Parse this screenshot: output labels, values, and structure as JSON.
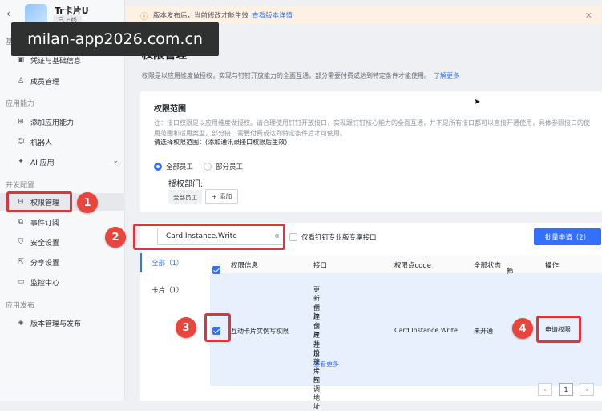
{
  "app": {
    "name": "Tr卡片U",
    "status_tag": "已上线"
  },
  "watermark": "milan-app2026.com.cn",
  "sidebar": {
    "sections": [
      {
        "label": "基础信息",
        "items": [
          {
            "label": "凭证与基础信息",
            "icon": "credential-icon"
          },
          {
            "label": "成员管理",
            "icon": "member-icon"
          }
        ]
      },
      {
        "label": "应用能力",
        "items": [
          {
            "label": "添加应用能力",
            "icon": "grid-icon"
          },
          {
            "label": "机器人",
            "icon": "robot-icon"
          },
          {
            "label": "AI 应用",
            "icon": "ai-icon"
          }
        ]
      },
      {
        "label": "开发配置",
        "items": [
          {
            "label": "权限管理",
            "icon": "permission-icon",
            "active": true
          },
          {
            "label": "事件订阅",
            "icon": "event-icon"
          },
          {
            "label": "安全设置",
            "icon": "shield-icon"
          },
          {
            "label": "分享设置",
            "icon": "share-icon"
          },
          {
            "label": "监控中心",
            "icon": "monitor-icon"
          }
        ]
      },
      {
        "label": "应用发布",
        "items": [
          {
            "label": "版本管理与发布",
            "icon": "version-icon"
          }
        ]
      }
    ]
  },
  "banner": {
    "text": "版本发布后，当前修改才能生效",
    "link": "查看版本详情"
  },
  "page": {
    "title": "权限管理",
    "desc": "权限是以应用维度做授权，实现与钉钉开放能力的全面互通，部分需要付费或达到特定条件才能使用。",
    "desc_link": "了解更多"
  },
  "scope": {
    "title": "权限范围",
    "note": "注：接口权限是以应用维度做授权。请合理使用钉钉开放接口，实现跟钉钉核心能力的全面互通，并不是所有接口都可以直接开通使用，具体参照接口的使用范围和适用类型，部分接口需要付费或达到特定条件后才可使用。",
    "pick": "请选择权限范围：(添加通讯录接口权限后生效)",
    "options": [
      "全部员工",
      "部分员工"
    ],
    "dept_label": "授权部门:",
    "dept_chip": "全部员工",
    "add_label": "+ 添加"
  },
  "search": {
    "value": "Card.Instance.Write",
    "clear": "⊗"
  },
  "pro_only": "仅看钉钉专业版专享接口",
  "batch_label": "批量申请（2）",
  "categories": [
    {
      "label": "全部（1）",
      "active": true
    },
    {
      "label": "卡片（1）"
    }
  ],
  "table": {
    "headers": {
      "info": "权限信息",
      "api": "接口",
      "code": "权限点code",
      "status": "全部状态",
      "filter": "筛选",
      "op": "操作"
    },
    "row": {
      "name": "互动卡片实例写权限",
      "apis": [
        "更新卡片",
        "创建卡片",
        "创建并投放卡片",
        "注册卡片回调地址"
      ],
      "more": "查看更多",
      "code": "Card.Instance.Write",
      "status": "未开通",
      "action": "申请权限"
    }
  },
  "pager": {
    "prev": "‹",
    "page": "1",
    "next": "›"
  },
  "annotations": [
    "1",
    "2",
    "3",
    "4"
  ]
}
